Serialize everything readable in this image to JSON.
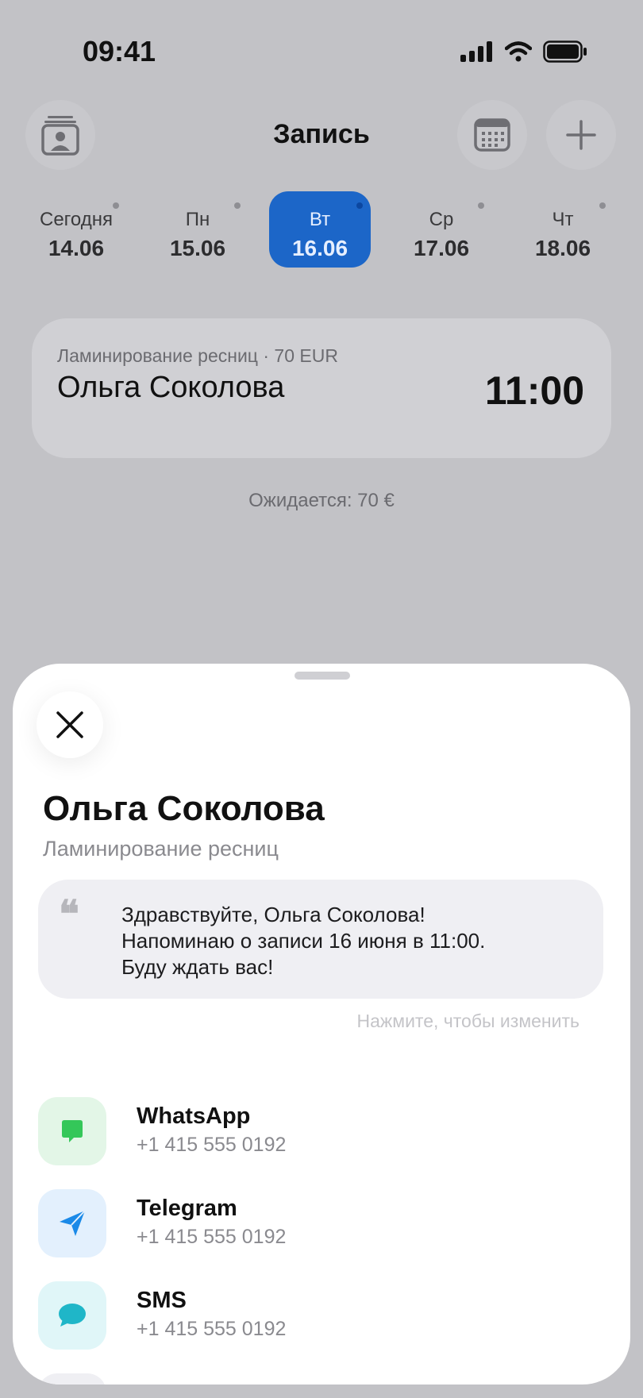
{
  "status_bar": {
    "time": "09:41"
  },
  "header": {
    "title": "Запись",
    "contacts_icon": "contact-card-icon",
    "calendar_icon": "calendar-icon",
    "add_icon": "plus-icon"
  },
  "days": [
    {
      "name": "Сегодня",
      "date": "14.06",
      "active": false
    },
    {
      "name": "Пн",
      "date": "15.06",
      "active": false
    },
    {
      "name": "Вт",
      "date": "16.06",
      "active": true
    },
    {
      "name": "Ср",
      "date": "17.06",
      "active": false
    },
    {
      "name": "Чт",
      "date": "18.06",
      "active": false
    }
  ],
  "appointment": {
    "meta": "Ламинирование ресниц  ·  70 EUR",
    "client": "Ольга Соколова",
    "time": "11:00"
  },
  "expected": "Ожидается: 70 €",
  "sheet": {
    "client_name": "Ольга Соколова",
    "service": "Ламинирование ресниц",
    "quote_mark": "❝",
    "message_lines": [
      "Здравствуйте, Ольга Соколова!",
      "Напоминаю о записи 16 июня в 11:00.",
      "Буду ждать вас!"
    ],
    "edit_hint": "Нажмите, чтобы изменить",
    "channels": [
      {
        "name": "WhatsApp",
        "phone": "+1 415 555 0192",
        "icon": "whatsapp-icon",
        "bg": "#e3f6e7",
        "color": "#34c759"
      },
      {
        "name": "Telegram",
        "phone": "+1 415 555 0192",
        "icon": "telegram-icon",
        "bg": "#e3f0fd",
        "color": "#1b8ae8"
      },
      {
        "name": "SMS",
        "phone": "+1 415 555 0192",
        "icon": "sms-icon",
        "bg": "#e0f6f8",
        "color": "#1fb6c8"
      }
    ]
  },
  "colors": {
    "accent": "#1c66c8",
    "background": "#c2c2c6"
  }
}
